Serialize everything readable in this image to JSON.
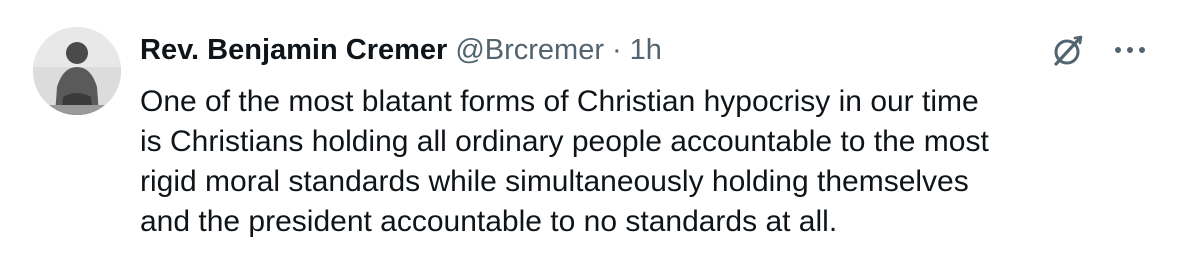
{
  "author": {
    "display_name": "Rev. Benjamin Cremer",
    "handle": "@Brcremer",
    "separator": "·",
    "time": "1h"
  },
  "icons": {
    "avatar": "profile-photo",
    "grok": "grok-icon",
    "more": "more-options-icon"
  },
  "tweet": {
    "lines": [
      "One of the most blatant forms of Christian hypocrisy in our time",
      "is Christians holding all ordinary people accountable to the most",
      "rigid moral standards while simultaneously holding themselves",
      "and the president accountable to no standards at all."
    ]
  },
  "colors": {
    "text": "#0f1419",
    "secondary": "#536471",
    "background": "#ffffff"
  }
}
